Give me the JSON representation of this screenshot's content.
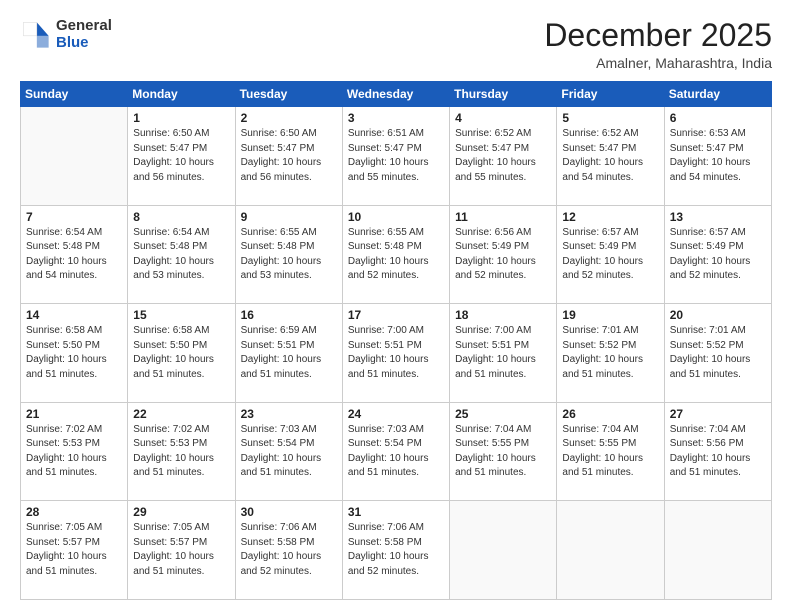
{
  "header": {
    "logo_line1": "General",
    "logo_line2": "Blue",
    "month": "December 2025",
    "location": "Amalner, Maharashtra, India"
  },
  "weekdays": [
    "Sunday",
    "Monday",
    "Tuesday",
    "Wednesday",
    "Thursday",
    "Friday",
    "Saturday"
  ],
  "weeks": [
    [
      {
        "day": "",
        "info": ""
      },
      {
        "day": "1",
        "info": "Sunrise: 6:50 AM\nSunset: 5:47 PM\nDaylight: 10 hours\nand 56 minutes."
      },
      {
        "day": "2",
        "info": "Sunrise: 6:50 AM\nSunset: 5:47 PM\nDaylight: 10 hours\nand 56 minutes."
      },
      {
        "day": "3",
        "info": "Sunrise: 6:51 AM\nSunset: 5:47 PM\nDaylight: 10 hours\nand 55 minutes."
      },
      {
        "day": "4",
        "info": "Sunrise: 6:52 AM\nSunset: 5:47 PM\nDaylight: 10 hours\nand 55 minutes."
      },
      {
        "day": "5",
        "info": "Sunrise: 6:52 AM\nSunset: 5:47 PM\nDaylight: 10 hours\nand 54 minutes."
      },
      {
        "day": "6",
        "info": "Sunrise: 6:53 AM\nSunset: 5:47 PM\nDaylight: 10 hours\nand 54 minutes."
      }
    ],
    [
      {
        "day": "7",
        "info": "Sunrise: 6:54 AM\nSunset: 5:48 PM\nDaylight: 10 hours\nand 54 minutes."
      },
      {
        "day": "8",
        "info": "Sunrise: 6:54 AM\nSunset: 5:48 PM\nDaylight: 10 hours\nand 53 minutes."
      },
      {
        "day": "9",
        "info": "Sunrise: 6:55 AM\nSunset: 5:48 PM\nDaylight: 10 hours\nand 53 minutes."
      },
      {
        "day": "10",
        "info": "Sunrise: 6:55 AM\nSunset: 5:48 PM\nDaylight: 10 hours\nand 52 minutes."
      },
      {
        "day": "11",
        "info": "Sunrise: 6:56 AM\nSunset: 5:49 PM\nDaylight: 10 hours\nand 52 minutes."
      },
      {
        "day": "12",
        "info": "Sunrise: 6:57 AM\nSunset: 5:49 PM\nDaylight: 10 hours\nand 52 minutes."
      },
      {
        "day": "13",
        "info": "Sunrise: 6:57 AM\nSunset: 5:49 PM\nDaylight: 10 hours\nand 52 minutes."
      }
    ],
    [
      {
        "day": "14",
        "info": "Sunrise: 6:58 AM\nSunset: 5:50 PM\nDaylight: 10 hours\nand 51 minutes."
      },
      {
        "day": "15",
        "info": "Sunrise: 6:58 AM\nSunset: 5:50 PM\nDaylight: 10 hours\nand 51 minutes."
      },
      {
        "day": "16",
        "info": "Sunrise: 6:59 AM\nSunset: 5:51 PM\nDaylight: 10 hours\nand 51 minutes."
      },
      {
        "day": "17",
        "info": "Sunrise: 7:00 AM\nSunset: 5:51 PM\nDaylight: 10 hours\nand 51 minutes."
      },
      {
        "day": "18",
        "info": "Sunrise: 7:00 AM\nSunset: 5:51 PM\nDaylight: 10 hours\nand 51 minutes."
      },
      {
        "day": "19",
        "info": "Sunrise: 7:01 AM\nSunset: 5:52 PM\nDaylight: 10 hours\nand 51 minutes."
      },
      {
        "day": "20",
        "info": "Sunrise: 7:01 AM\nSunset: 5:52 PM\nDaylight: 10 hours\nand 51 minutes."
      }
    ],
    [
      {
        "day": "21",
        "info": "Sunrise: 7:02 AM\nSunset: 5:53 PM\nDaylight: 10 hours\nand 51 minutes."
      },
      {
        "day": "22",
        "info": "Sunrise: 7:02 AM\nSunset: 5:53 PM\nDaylight: 10 hours\nand 51 minutes."
      },
      {
        "day": "23",
        "info": "Sunrise: 7:03 AM\nSunset: 5:54 PM\nDaylight: 10 hours\nand 51 minutes."
      },
      {
        "day": "24",
        "info": "Sunrise: 7:03 AM\nSunset: 5:54 PM\nDaylight: 10 hours\nand 51 minutes."
      },
      {
        "day": "25",
        "info": "Sunrise: 7:04 AM\nSunset: 5:55 PM\nDaylight: 10 hours\nand 51 minutes."
      },
      {
        "day": "26",
        "info": "Sunrise: 7:04 AM\nSunset: 5:55 PM\nDaylight: 10 hours\nand 51 minutes."
      },
      {
        "day": "27",
        "info": "Sunrise: 7:04 AM\nSunset: 5:56 PM\nDaylight: 10 hours\nand 51 minutes."
      }
    ],
    [
      {
        "day": "28",
        "info": "Sunrise: 7:05 AM\nSunset: 5:57 PM\nDaylight: 10 hours\nand 51 minutes."
      },
      {
        "day": "29",
        "info": "Sunrise: 7:05 AM\nSunset: 5:57 PM\nDaylight: 10 hours\nand 51 minutes."
      },
      {
        "day": "30",
        "info": "Sunrise: 7:06 AM\nSunset: 5:58 PM\nDaylight: 10 hours\nand 52 minutes."
      },
      {
        "day": "31",
        "info": "Sunrise: 7:06 AM\nSunset: 5:58 PM\nDaylight: 10 hours\nand 52 minutes."
      },
      {
        "day": "",
        "info": ""
      },
      {
        "day": "",
        "info": ""
      },
      {
        "day": "",
        "info": ""
      }
    ]
  ]
}
